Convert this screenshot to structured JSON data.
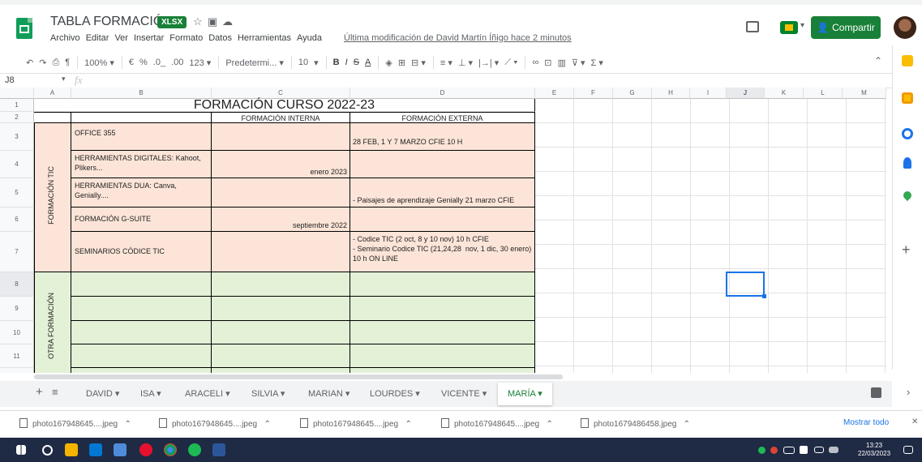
{
  "app": {
    "doc_title": "TABLA FORMACIÓN",
    "file_badge": "XLSX",
    "menu": [
      "Archivo",
      "Editar",
      "Ver",
      "Insertar",
      "Formato",
      "Datos",
      "Herramientas",
      "Ayuda"
    ],
    "last_edit": "Última modificación de David Martín Íñigo hace 2 minutos",
    "share_label": "Compartir"
  },
  "toolbar": {
    "zoom": "100% ▾",
    "currency": "€",
    "percent": "%",
    "dec_less": ".0_",
    "dec_more": ".00",
    "format_more": "123 ▾",
    "font": "Predetermi... ▾",
    "font_size": "10",
    "bold": "B",
    "italic": "I",
    "strike": "S",
    "text_color": "A"
  },
  "formula_bar": {
    "namebox": "J8",
    "fx": "fx"
  },
  "columns": [
    "A",
    "B",
    "C",
    "D",
    "E",
    "F",
    "G",
    "H",
    "I",
    "J",
    "K",
    "L",
    "M"
  ],
  "rows": [
    "1",
    "2",
    "3",
    "4",
    "5",
    "6",
    "7",
    "8",
    "9",
    "10",
    "11"
  ],
  "sheet": {
    "title": "FORMACIÓN CURSO 2022-23",
    "col_internal": "FORMACIÓN INTERNA",
    "col_external": "FORMACIÓN EXTERNA",
    "group_tic": "FORMACIÓN TIC",
    "group_other": "OTRA FORMACIÓN",
    "r3": {
      "name": "OFFICE 355",
      "internal": "",
      "external": "28 FEB, 1 Y 7 MARZO CFIE 10 H"
    },
    "r4": {
      "name": "HERRAMIENTAS DIGITALES: Kahoot, Plikers...",
      "internal": "enero 2023",
      "external": ""
    },
    "r5": {
      "name": "HERRAMIENTAS DUA: Canva, Genially....",
      "internal": "",
      "external": "- Paisajes de aprendizaje Genially 21 marzo CFIE"
    },
    "r6": {
      "name": "FORMACIÓN G-SUITE",
      "internal": "septiembre 2022",
      "external": ""
    },
    "r7": {
      "name": "SEMINARIOS CÓDICE TIC",
      "internal": "",
      "external": "- Codice TIC (2 oct, 8 y 10 nov) 10 h CFIE\n- Seminario Codice TIC (21,24,28  nov, 1 dic, 30 enero) 10 h ON LINE"
    }
  },
  "tabs": [
    "DAVID ▾",
    "ISA ▾",
    "ARACELI ▾",
    "SILVIA ▾",
    "MARIAN ▾",
    "LOURDES ▾",
    "VICENTE ▾",
    "MARÍA ▾"
  ],
  "downloads": [
    "photo167948645....jpeg",
    "photo167948645....jpeg",
    "photo167948645....jpeg",
    "photo167948645....jpeg",
    "photo1679486458.jpeg"
  ],
  "show_all": "Mostrar todo",
  "clock": {
    "time": "13:23",
    "date": "22/03/2023"
  },
  "colors": {
    "orange_fill": "#fce5d8",
    "green_fill": "#e3f1d7",
    "share_green": "#188038",
    "selection_blue": "#1a73e8"
  }
}
